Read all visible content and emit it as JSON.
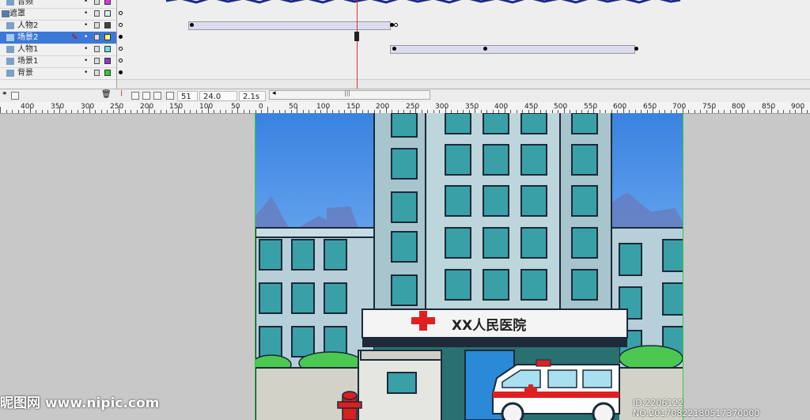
{
  "layers": [
    {
      "name": "音频",
      "color": "#d23cd2",
      "selected": false
    },
    {
      "name": "遮罩",
      "color": "#d8ecff",
      "selected": false
    },
    {
      "name": "人物2",
      "color": "#444444",
      "selected": false
    },
    {
      "name": "场景2",
      "color": "#ffff66",
      "selected": true
    },
    {
      "name": "人物1",
      "color": "#66e0e8",
      "selected": false
    },
    {
      "name": "场景1",
      "color": "#9933cc",
      "selected": false
    },
    {
      "name": "背景",
      "color": "#33cc33",
      "selected": false
    }
  ],
  "status": {
    "current_frame": "51",
    "frame_rate": "24.0 fps",
    "elapsed_time": "2.1s"
  },
  "ruler_labels": [
    "400",
    "350",
    "300",
    "250",
    "200",
    "150",
    "100",
    "50",
    "0",
    "50",
    "100",
    "150",
    "200",
    "250",
    "300",
    "350",
    "400",
    "450",
    "500",
    "550",
    "600",
    "650",
    "700",
    "750",
    "800",
    "850",
    "900"
  ],
  "sign": {
    "hospital_name": "XX人民医院"
  },
  "watermark": {
    "site": "昵图网 www.nipic.com",
    "id_text": "ID:2206122 NO:20170822180517370000"
  },
  "colors": {
    "selection": "#3b78d8",
    "playhead": "#e03030",
    "sky": "#3a82e0",
    "building": "#b8d4dc",
    "window": "#3aa0a8",
    "cross": "#e02020"
  }
}
